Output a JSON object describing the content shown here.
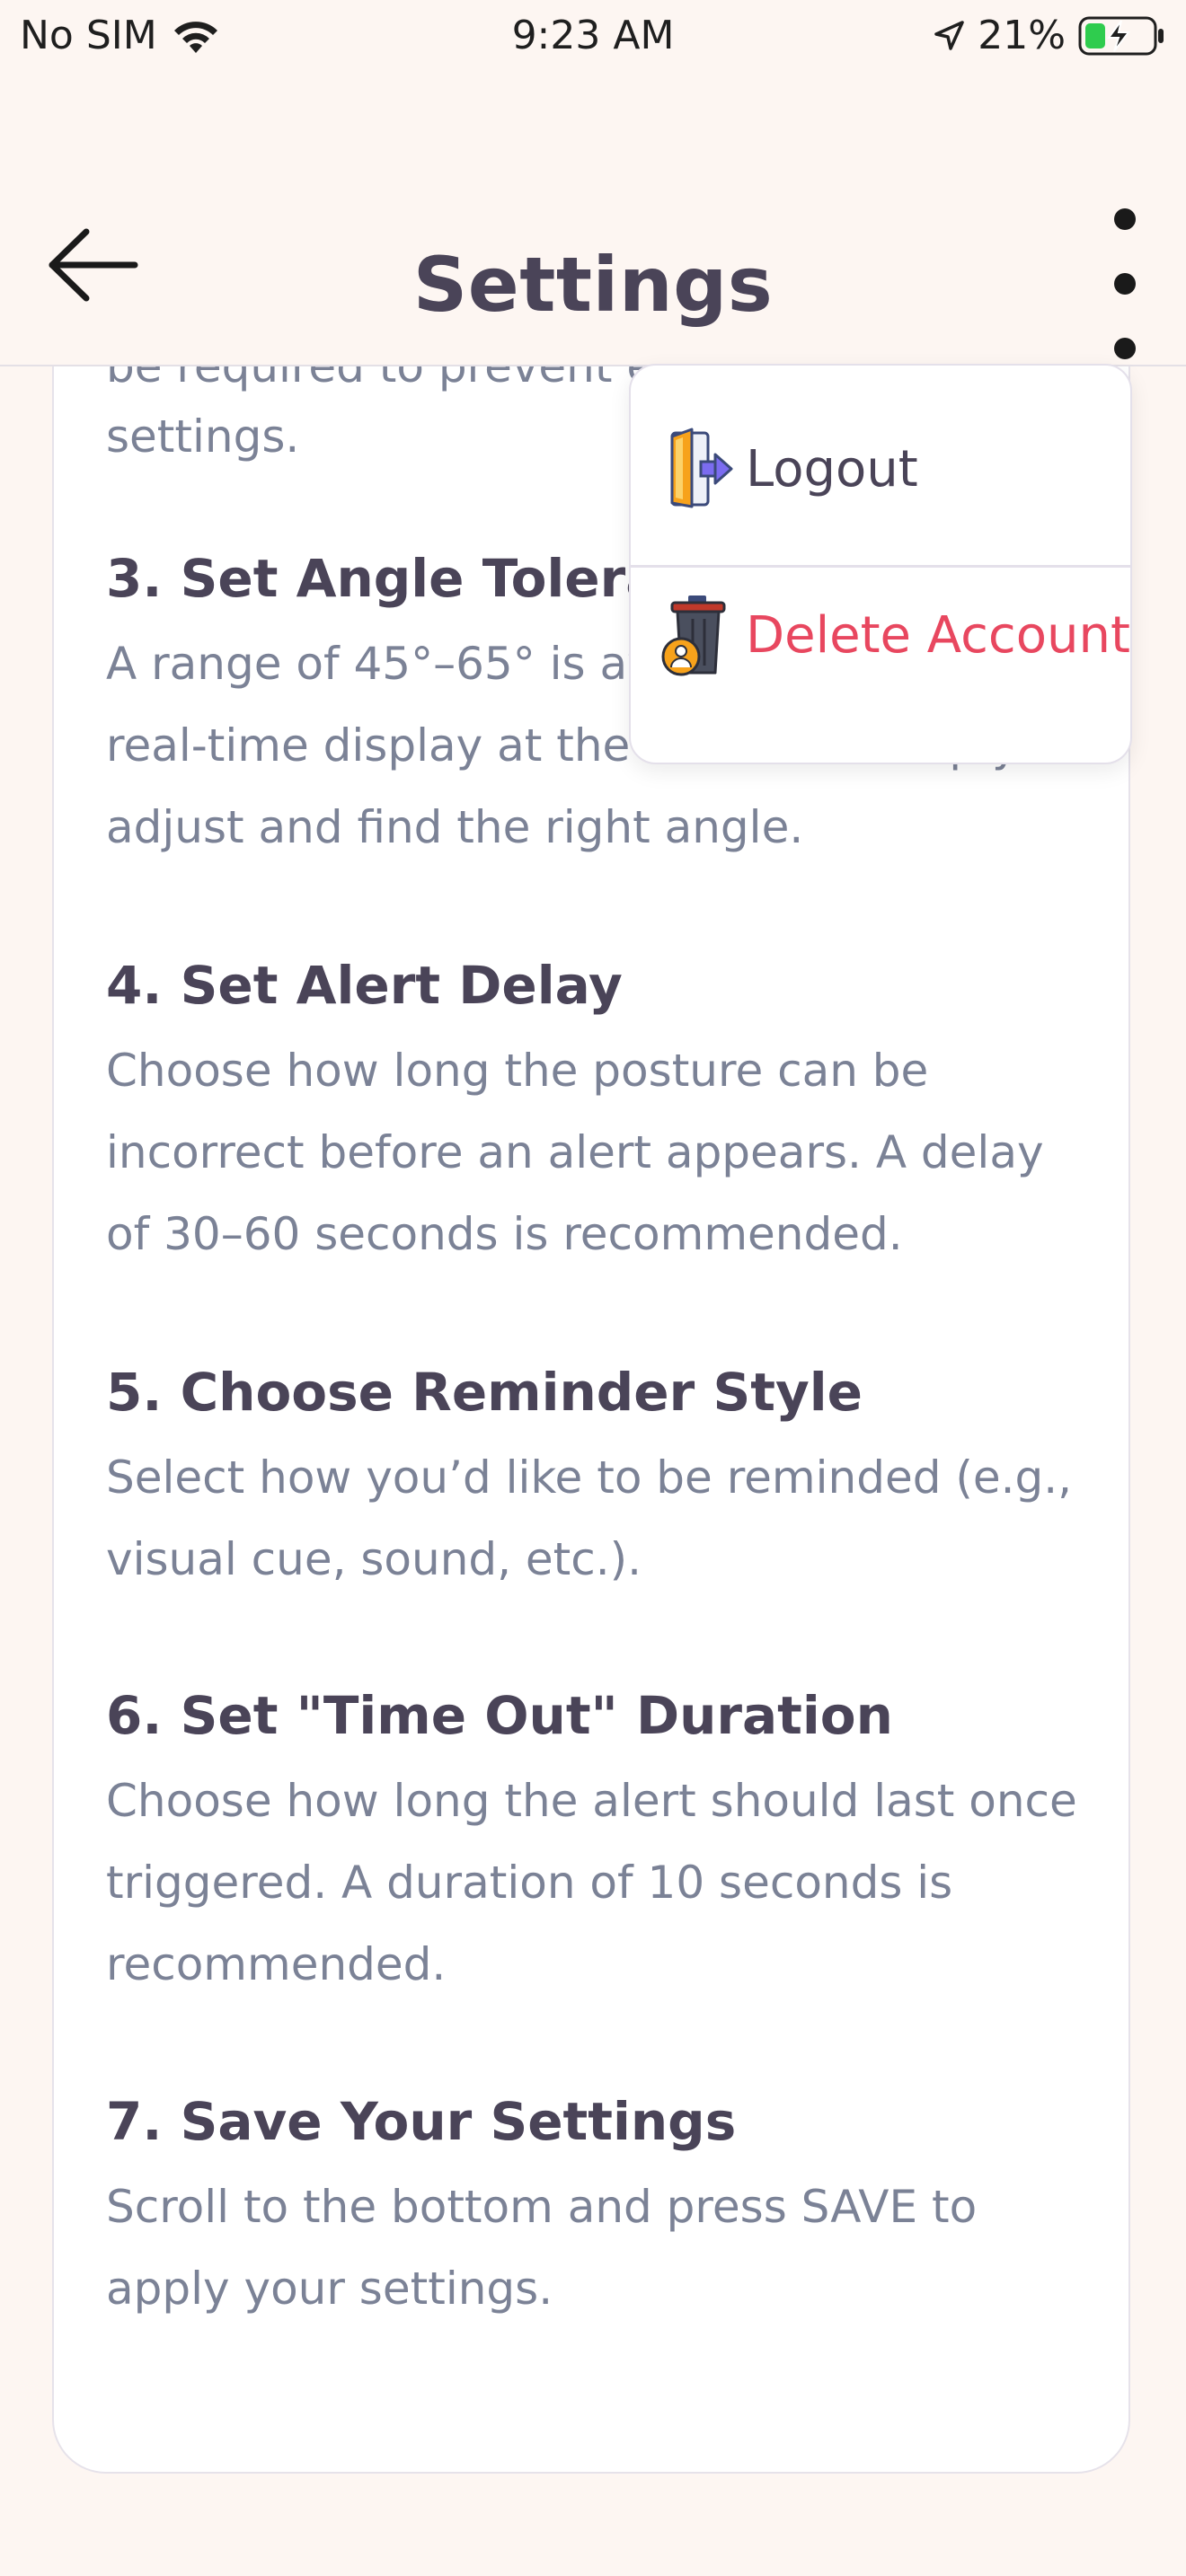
{
  "status_bar": {
    "carrier": "No SIM",
    "time": "9:23 AM",
    "battery_percent": "21%",
    "icons": [
      "wifi-icon",
      "location-icon",
      "battery-charging-icon"
    ]
  },
  "header": {
    "title": "Settings",
    "back_icon": "arrow-left-icon",
    "more_icon": "more-vertical-icon"
  },
  "content": {
    "clipped_text": "be required to prevent e",
    "previous_step_end": "settings.",
    "steps": [
      {
        "title": "3. Set Angle Tolerance",
        "body": "A range of 45°–65° is available. Use the real-time display at the bottom to help you adjust and find the right angle."
      },
      {
        "title": "4. Set Alert Delay",
        "body": "Choose how long the posture can be incorrect before an alert appears. A delay of 30–60 seconds is recommended."
      },
      {
        "title": "5. Choose Reminder Style",
        "body": "Select how you’d like to be reminded (e.g., visual cue, sound, etc.)."
      },
      {
        "title": "6. Set \"Time Out\" Duration",
        "body": "Choose how long the alert should last once triggered. A duration of 10 seconds is recommended."
      },
      {
        "title": "7. Save Your Settings",
        "body": "Scroll to the bottom and press SAVE to apply your settings."
      }
    ]
  },
  "menu": {
    "items": [
      {
        "label": "Logout",
        "icon": "logout-door-icon",
        "color": "#4a4458"
      },
      {
        "label": "Delete Account",
        "icon": "trash-user-icon",
        "color": "#e8475f"
      }
    ]
  }
}
